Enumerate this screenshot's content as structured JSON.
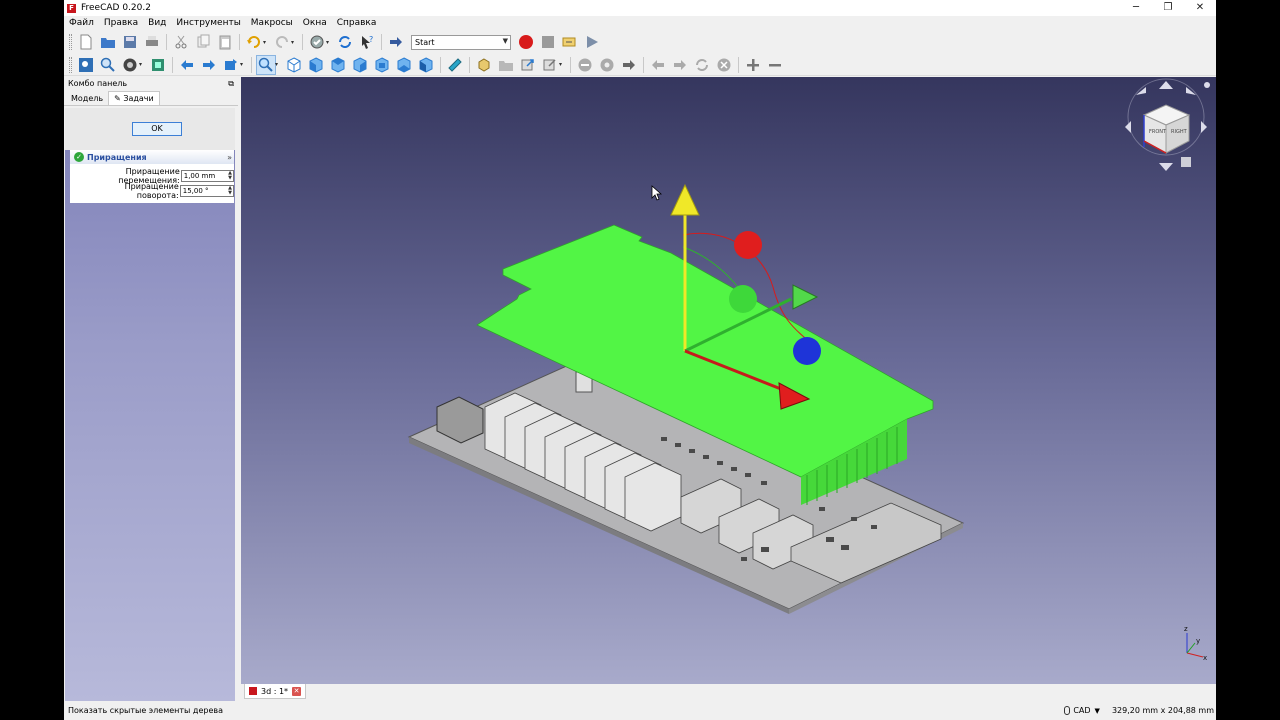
{
  "window": {
    "title": "FreeCAD 0.20.2",
    "logo": "freecad-logo-icon",
    "minimize": "─",
    "maximize": "❐",
    "close": "✕"
  },
  "menu": [
    "Файл",
    "Правка",
    "Вид",
    "Инструменты",
    "Макросы",
    "Окна",
    "Справка"
  ],
  "toolbar": {
    "macro_select": "Start"
  },
  "combo": {
    "title": "Комбо панель",
    "tabs": [
      "Модель",
      "Задачи"
    ],
    "ok_label": "OK",
    "increments": {
      "title": "Приращения",
      "move_label": "Приращение перемещения:",
      "move_value": "1,00 mm",
      "rotate_label": "Приращение поворота:",
      "rotate_value": "15,00 °"
    }
  },
  "doc_tab": {
    "label": "3d : 1*"
  },
  "status": {
    "message": "Показать скрытые элементы дерева",
    "nav_style": "CAD",
    "dimensions": "329,20 mm x 204,88 mm"
  },
  "navcube": {
    "faces": [
      "FRONT",
      "RIGHT"
    ]
  },
  "axes": {
    "z": "z",
    "y": "y",
    "x": "x"
  },
  "colors": {
    "accent": "#3c7fd6",
    "selection": "#52f545",
    "record": "#d81b1b"
  }
}
